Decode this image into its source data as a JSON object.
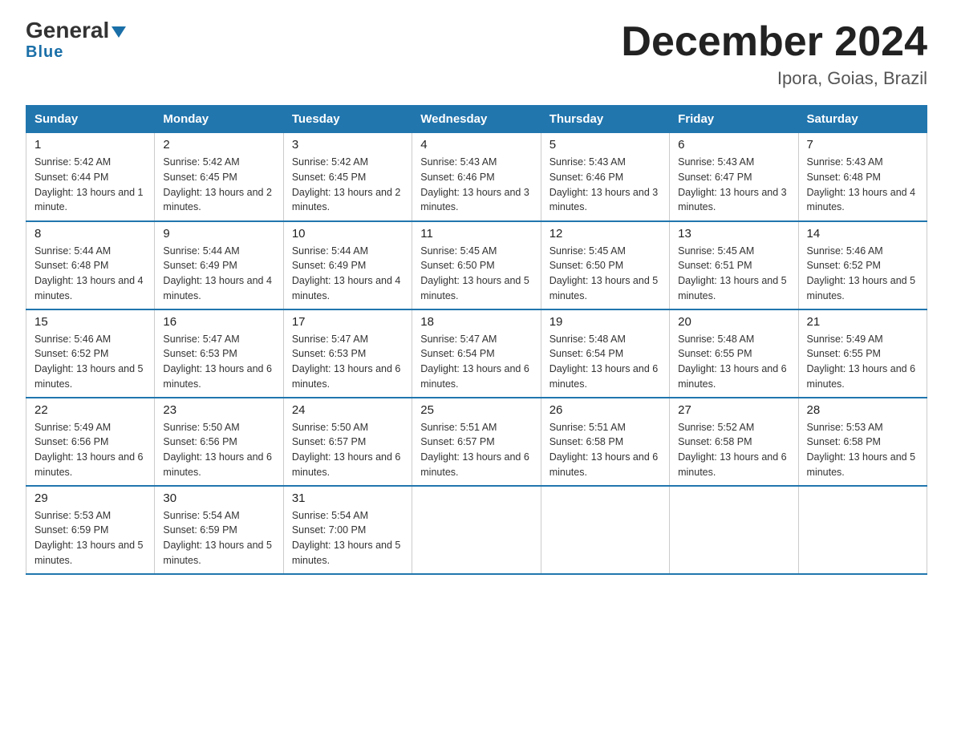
{
  "header": {
    "logo_main": "General",
    "logo_sub": "Blue",
    "title": "December 2024",
    "subtitle": "Ipora, Goias, Brazil"
  },
  "weekdays": [
    "Sunday",
    "Monday",
    "Tuesday",
    "Wednesday",
    "Thursday",
    "Friday",
    "Saturday"
  ],
  "weeks": [
    [
      {
        "day": "1",
        "sunrise": "5:42 AM",
        "sunset": "6:44 PM",
        "daylight": "13 hours and 1 minute."
      },
      {
        "day": "2",
        "sunrise": "5:42 AM",
        "sunset": "6:45 PM",
        "daylight": "13 hours and 2 minutes."
      },
      {
        "day": "3",
        "sunrise": "5:42 AM",
        "sunset": "6:45 PM",
        "daylight": "13 hours and 2 minutes."
      },
      {
        "day": "4",
        "sunrise": "5:43 AM",
        "sunset": "6:46 PM",
        "daylight": "13 hours and 3 minutes."
      },
      {
        "day": "5",
        "sunrise": "5:43 AM",
        "sunset": "6:46 PM",
        "daylight": "13 hours and 3 minutes."
      },
      {
        "day": "6",
        "sunrise": "5:43 AM",
        "sunset": "6:47 PM",
        "daylight": "13 hours and 3 minutes."
      },
      {
        "day": "7",
        "sunrise": "5:43 AM",
        "sunset": "6:48 PM",
        "daylight": "13 hours and 4 minutes."
      }
    ],
    [
      {
        "day": "8",
        "sunrise": "5:44 AM",
        "sunset": "6:48 PM",
        "daylight": "13 hours and 4 minutes."
      },
      {
        "day": "9",
        "sunrise": "5:44 AM",
        "sunset": "6:49 PM",
        "daylight": "13 hours and 4 minutes."
      },
      {
        "day": "10",
        "sunrise": "5:44 AM",
        "sunset": "6:49 PM",
        "daylight": "13 hours and 4 minutes."
      },
      {
        "day": "11",
        "sunrise": "5:45 AM",
        "sunset": "6:50 PM",
        "daylight": "13 hours and 5 minutes."
      },
      {
        "day": "12",
        "sunrise": "5:45 AM",
        "sunset": "6:50 PM",
        "daylight": "13 hours and 5 minutes."
      },
      {
        "day": "13",
        "sunrise": "5:45 AM",
        "sunset": "6:51 PM",
        "daylight": "13 hours and 5 minutes."
      },
      {
        "day": "14",
        "sunrise": "5:46 AM",
        "sunset": "6:52 PM",
        "daylight": "13 hours and 5 minutes."
      }
    ],
    [
      {
        "day": "15",
        "sunrise": "5:46 AM",
        "sunset": "6:52 PM",
        "daylight": "13 hours and 5 minutes."
      },
      {
        "day": "16",
        "sunrise": "5:47 AM",
        "sunset": "6:53 PM",
        "daylight": "13 hours and 6 minutes."
      },
      {
        "day": "17",
        "sunrise": "5:47 AM",
        "sunset": "6:53 PM",
        "daylight": "13 hours and 6 minutes."
      },
      {
        "day": "18",
        "sunrise": "5:47 AM",
        "sunset": "6:54 PM",
        "daylight": "13 hours and 6 minutes."
      },
      {
        "day": "19",
        "sunrise": "5:48 AM",
        "sunset": "6:54 PM",
        "daylight": "13 hours and 6 minutes."
      },
      {
        "day": "20",
        "sunrise": "5:48 AM",
        "sunset": "6:55 PM",
        "daylight": "13 hours and 6 minutes."
      },
      {
        "day": "21",
        "sunrise": "5:49 AM",
        "sunset": "6:55 PM",
        "daylight": "13 hours and 6 minutes."
      }
    ],
    [
      {
        "day": "22",
        "sunrise": "5:49 AM",
        "sunset": "6:56 PM",
        "daylight": "13 hours and 6 minutes."
      },
      {
        "day": "23",
        "sunrise": "5:50 AM",
        "sunset": "6:56 PM",
        "daylight": "13 hours and 6 minutes."
      },
      {
        "day": "24",
        "sunrise": "5:50 AM",
        "sunset": "6:57 PM",
        "daylight": "13 hours and 6 minutes."
      },
      {
        "day": "25",
        "sunrise": "5:51 AM",
        "sunset": "6:57 PM",
        "daylight": "13 hours and 6 minutes."
      },
      {
        "day": "26",
        "sunrise": "5:51 AM",
        "sunset": "6:58 PM",
        "daylight": "13 hours and 6 minutes."
      },
      {
        "day": "27",
        "sunrise": "5:52 AM",
        "sunset": "6:58 PM",
        "daylight": "13 hours and 6 minutes."
      },
      {
        "day": "28",
        "sunrise": "5:53 AM",
        "sunset": "6:58 PM",
        "daylight": "13 hours and 5 minutes."
      }
    ],
    [
      {
        "day": "29",
        "sunrise": "5:53 AM",
        "sunset": "6:59 PM",
        "daylight": "13 hours and 5 minutes."
      },
      {
        "day": "30",
        "sunrise": "5:54 AM",
        "sunset": "6:59 PM",
        "daylight": "13 hours and 5 minutes."
      },
      {
        "day": "31",
        "sunrise": "5:54 AM",
        "sunset": "7:00 PM",
        "daylight": "13 hours and 5 minutes."
      },
      null,
      null,
      null,
      null
    ]
  ],
  "labels": {
    "sunrise": "Sunrise:",
    "sunset": "Sunset:",
    "daylight": "Daylight:"
  }
}
